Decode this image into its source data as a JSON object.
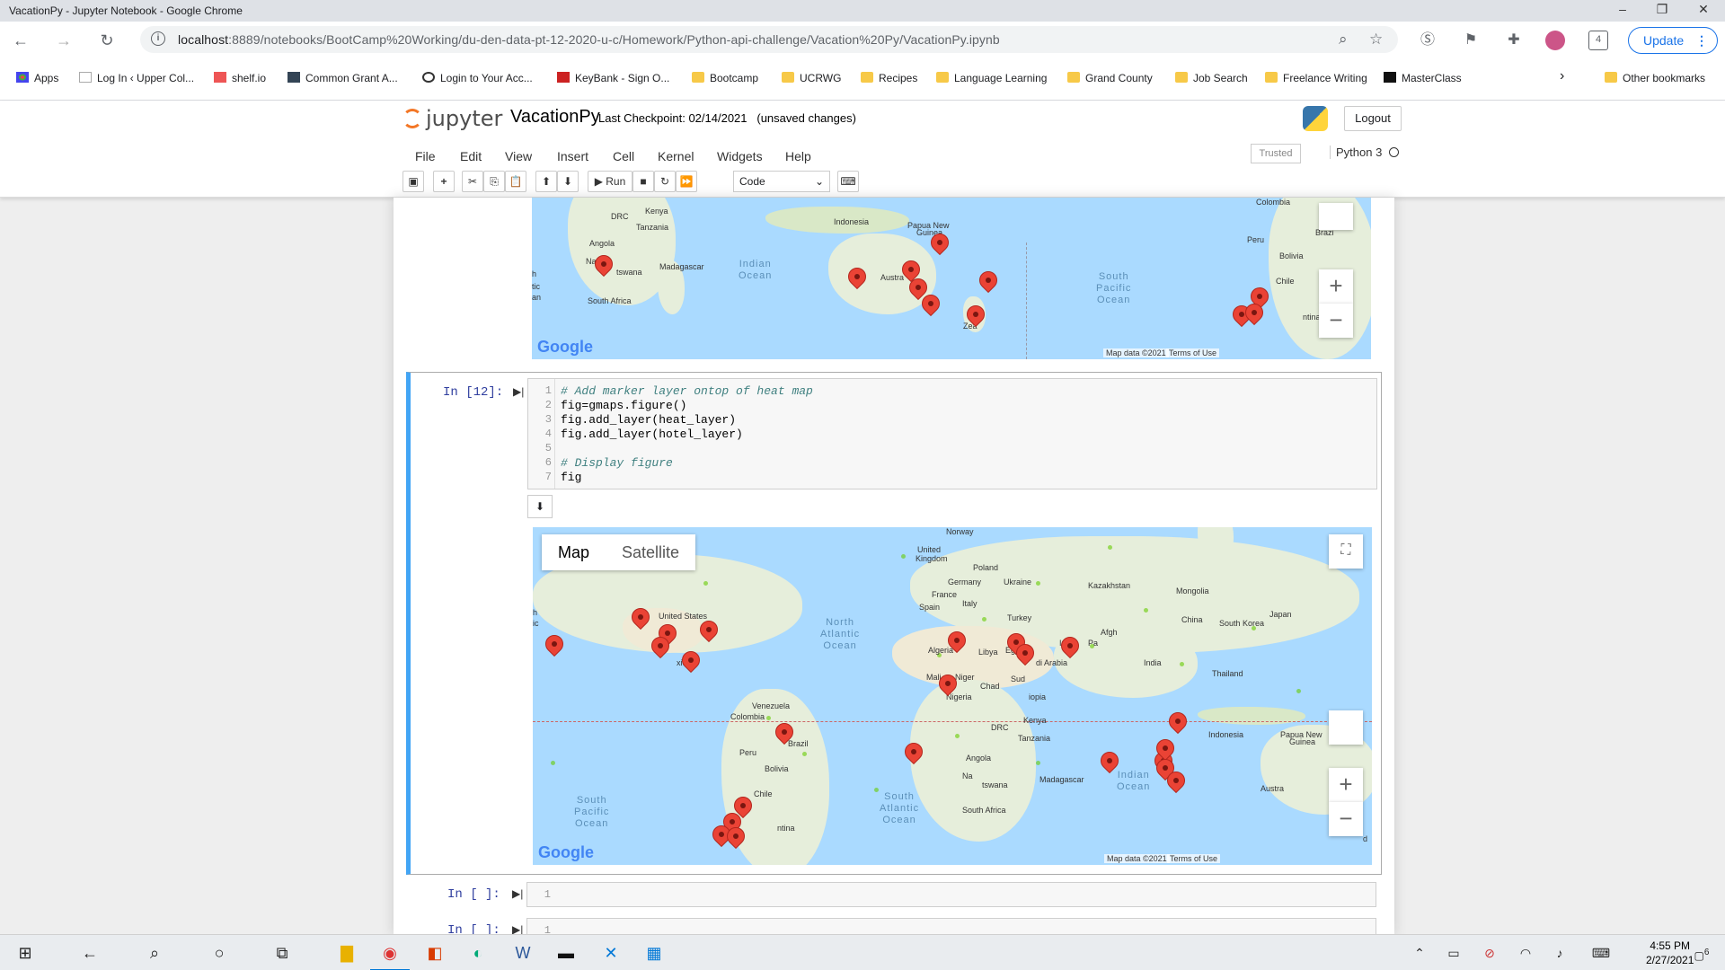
{
  "window": {
    "title": "VacationPy - Jupyter Notebook - Google Chrome",
    "minimize": "–",
    "restore": "❐",
    "close": "✕"
  },
  "browser": {
    "url_host": "localhost",
    "url_rest": ":8889/notebooks/BootCamp%20Working/du-den-data-pt-12-2020-u-c/Homework/Python-api-challenge/Vacation%20Py/VacationPy.ipynb",
    "update_label": "Update",
    "profile_count": "4",
    "bookmarks": [
      "Apps",
      "Log In ‹ Upper Col...",
      "shelf.io",
      "Common Grant A...",
      "Login to Your Acc...",
      "KeyBank - Sign O...",
      "Bootcamp",
      "UCRWG",
      "Recipes",
      "Language Learning",
      "Grand County",
      "Job Search",
      "Freelance Writing",
      "MasterClass"
    ],
    "other_bookmarks": "Other bookmarks"
  },
  "jupyter": {
    "logo_text": "jupyter",
    "notebook_name": "VacationPy",
    "checkpoint": "Last Checkpoint: 02/14/2021",
    "unsaved": "(unsaved changes)",
    "logout": "Logout",
    "menus": [
      "File",
      "Edit",
      "View",
      "Insert",
      "Cell",
      "Kernel",
      "Widgets",
      "Help"
    ],
    "trusted": "Trusted",
    "kernel": "Python 3",
    "run_label": "Run",
    "cell_type": "Code"
  },
  "map1": {
    "labels": [
      "DRC",
      "Kenya",
      "Tanzania",
      "Angola",
      "Na",
      "tswana",
      "South Africa",
      "Madagascar",
      "Indonesia",
      "Papua New",
      "Guinea",
      "Austra",
      "Zea",
      "Colombia",
      "Peru",
      "Bolivia",
      "Brazi",
      "Chile",
      "ntina",
      "h",
      "tic",
      "an"
    ],
    "oceans": [
      "Indian\nOcean",
      "South\nPacific\nOcean"
    ],
    "google": "Google",
    "map_data": "Map data ©2021",
    "terms": "Terms of Use"
  },
  "cell12": {
    "prompt": "In [12]:",
    "lines": [
      {
        "n": "1",
        "text": "# Add marker layer ontop of heat map",
        "comment": true
      },
      {
        "n": "2",
        "text": "fig=gmaps.figure()",
        "comment": false
      },
      {
        "n": "3",
        "text": "fig.add_layer(heat_layer)",
        "comment": false
      },
      {
        "n": "4",
        "text": "fig.add_layer(hotel_layer)",
        "comment": false
      },
      {
        "n": "5",
        "text": "",
        "comment": false
      },
      {
        "n": "6",
        "text": "# Display figure",
        "comment": true
      },
      {
        "n": "7",
        "text": "fig",
        "comment": false
      }
    ]
  },
  "map2": {
    "map_btn": "Map",
    "satellite_btn": "Satellite",
    "labels": [
      "Norway",
      "United",
      "Kingdom",
      "Poland",
      "Germany",
      "Ukraine",
      "Kazakhstan",
      "Mongolia",
      "France",
      "Italy",
      "Spain",
      "Turkey",
      "China",
      "South Korea",
      "Japan",
      "United States",
      "xico",
      "Algeria",
      "Libya",
      "Egypt",
      "Iran",
      "Afgh",
      "Pa",
      "India",
      "Thailand",
      "di Arabia",
      "Mali",
      "Niger",
      "Chad",
      "Sud",
      "Nigeria",
      "iopia",
      "Kenya",
      "DRC",
      "Tanzania",
      "Venezuela",
      "Colombia",
      "Peru",
      "Brazil",
      "Bolivia",
      "Chile",
      "ntina",
      "Angola",
      "Na",
      "tswana",
      "South Africa",
      "Madagascar",
      "Indonesia",
      "Papua New",
      "Guinea",
      "Austra",
      "h",
      "ic",
      "d"
    ],
    "oceans": [
      "North\nAtlantic\nOcean",
      "South\nAtlantic\nOcean",
      "South\nPacific\nOcean",
      "Indian\nOcean"
    ],
    "google": "Google",
    "map_data": "Map data ©2021",
    "terms": "Terms of Use"
  },
  "empty_cells": [
    {
      "prompt": "In [ ]:",
      "n": "1"
    },
    {
      "prompt": "In [ ]:",
      "n": "1"
    }
  ],
  "taskbar": {
    "time": "4:55 PM",
    "date": "2/27/2021",
    "notifications": "6"
  }
}
